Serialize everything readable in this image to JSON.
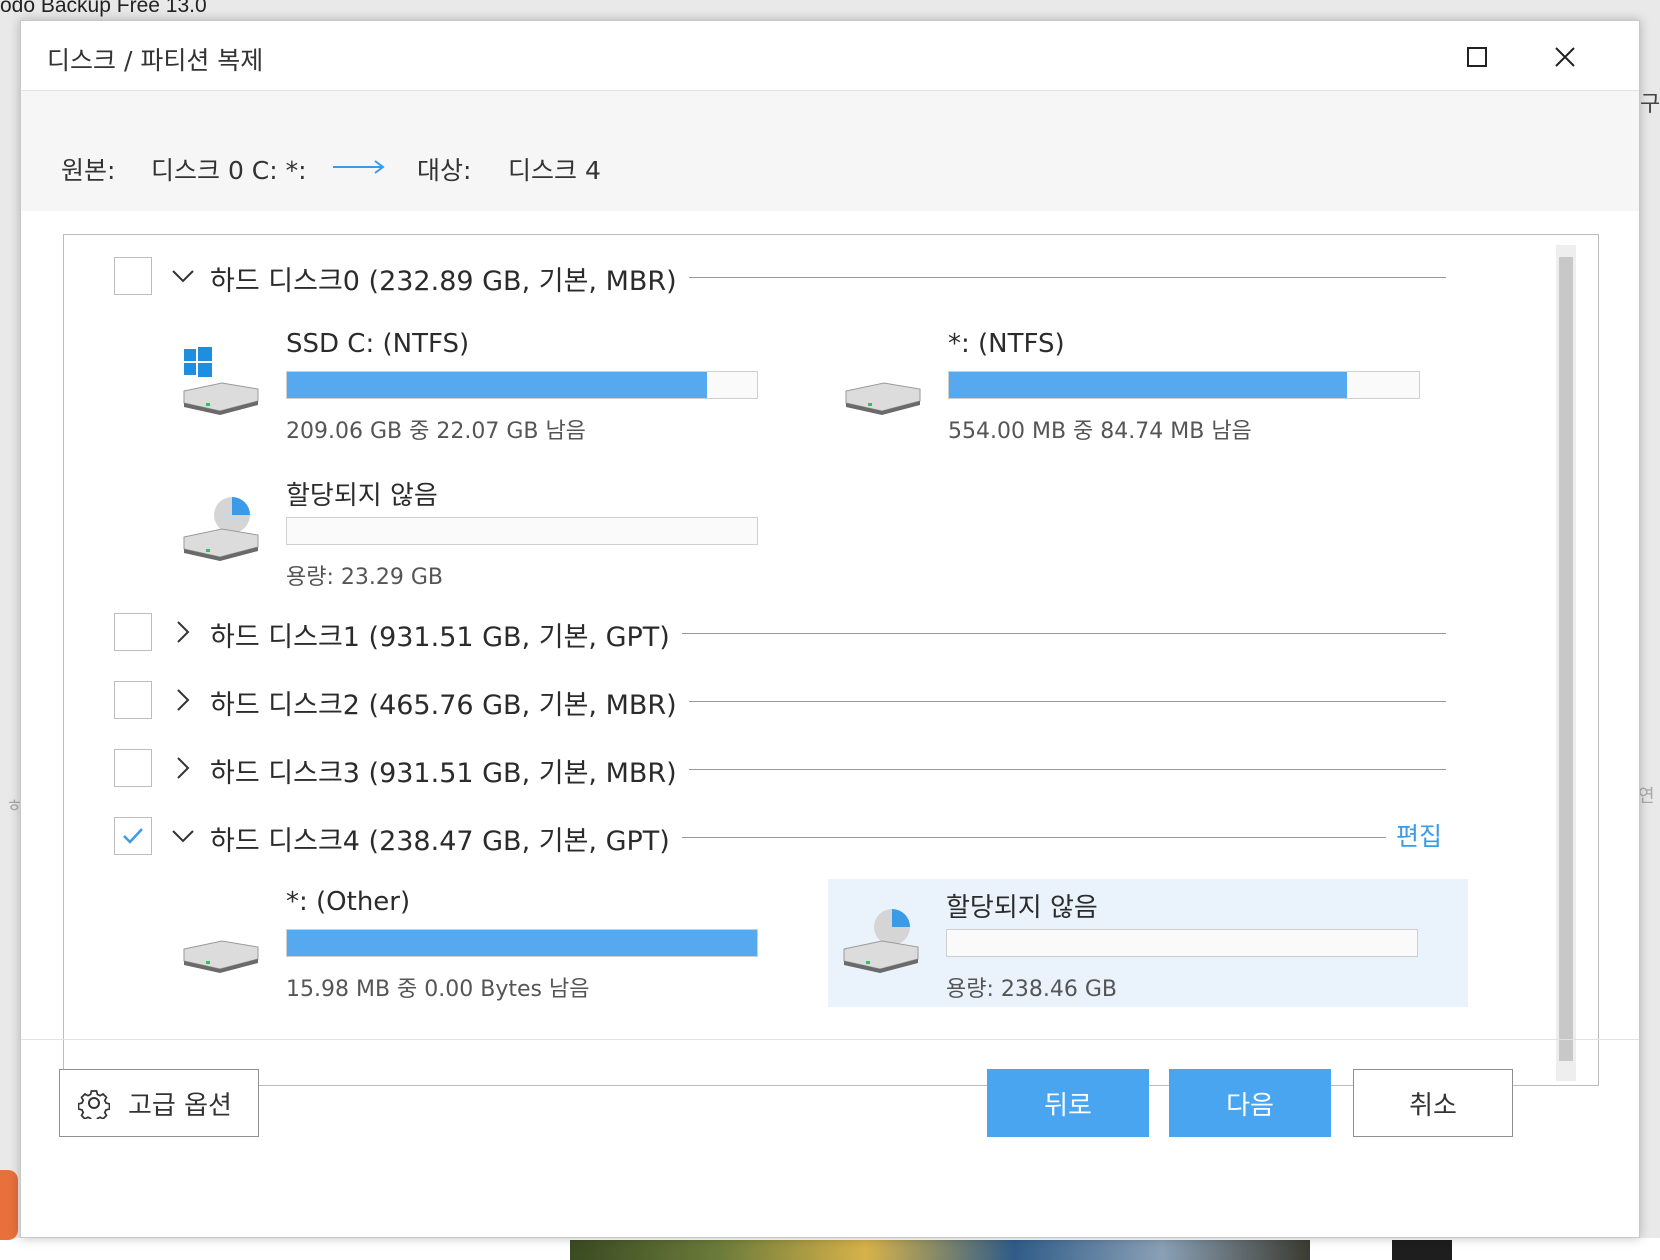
{
  "background": {
    "app_title": "odo Backup Free 13.0",
    "right_glyph_top": "구",
    "right_glyph_mid": "연",
    "left_glyph_mid": "ㅎ"
  },
  "dialog": {
    "title": "디스크 / 파티션 복제",
    "source_label": "원본:",
    "source_value": "디스크 0 C: *:",
    "target_label": "대상:",
    "target_value": "디스크 4"
  },
  "disks": [
    {
      "label": "하드 디스크0 (232.89 GB, 기본, MBR)",
      "checked": false,
      "expanded": true,
      "partitions": [
        {
          "name": "SSD C: (NTFS)",
          "icon": "windows-drive-icon",
          "used_fraction": 0.894,
          "info": "209.06 GB 중 22.07 GB  남음"
        },
        {
          "name": "*: (NTFS)",
          "icon": "drive-icon",
          "used_fraction": 0.847,
          "info": "554.00 MB 중 84.74 MB  남음"
        },
        {
          "name": "할당되지 않음",
          "icon": "unallocated-drive-icon",
          "used_fraction": 0,
          "info": "용량: 23.29 GB"
        }
      ]
    },
    {
      "label": "하드 디스크1 (931.51 GB, 기본, GPT)",
      "checked": false,
      "expanded": false
    },
    {
      "label": "하드 디스크2 (465.76 GB, 기본, MBR)",
      "checked": false,
      "expanded": false
    },
    {
      "label": "하드 디스크3 (931.51 GB, 기본, MBR)",
      "checked": false,
      "expanded": false
    },
    {
      "label": "하드 디스크4 (238.47 GB, 기본, GPT)",
      "checked": true,
      "expanded": true,
      "edit_label": "편집",
      "partitions": [
        {
          "name": "*: (Other)",
          "icon": "drive-icon",
          "used_fraction": 1.0,
          "info": "15.98 MB 중 0.00 Bytes  남음"
        },
        {
          "name": "할당되지 않음",
          "icon": "unallocated-drive-icon",
          "used_fraction": 0,
          "info": "용량: 238.46 GB",
          "selected": true
        }
      ]
    }
  ],
  "footer": {
    "advanced_label": "고급 옵션",
    "back_label": "뒤로",
    "next_label": "다음",
    "cancel_label": "취소"
  },
  "colors": {
    "accent": "#4aa5f0",
    "bar_fill": "#56a9ee",
    "selected_bg": "#eaf3fc",
    "link": "#3c9be8"
  }
}
